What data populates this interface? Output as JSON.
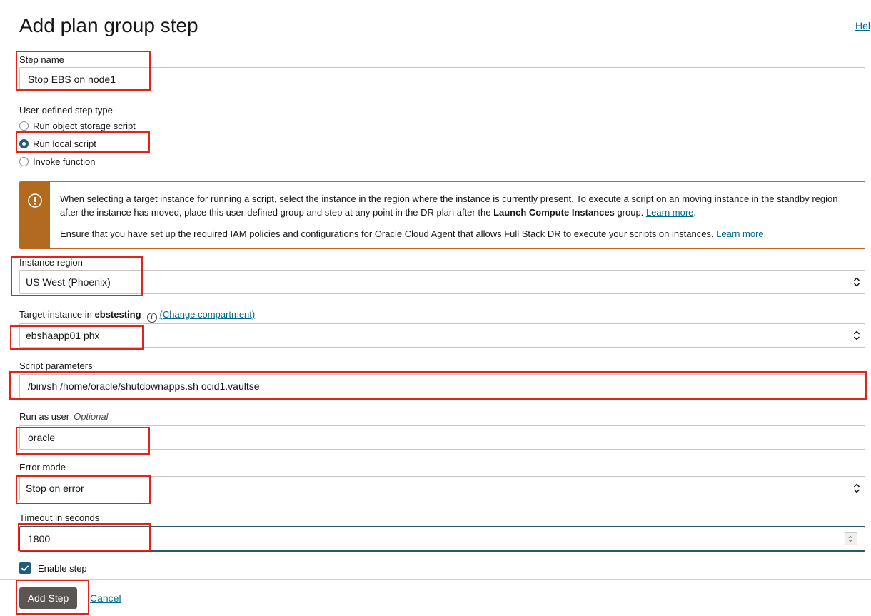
{
  "header": {
    "title": "Add plan group step",
    "help_label": "Help"
  },
  "form": {
    "step_name_label": "Step name",
    "step_name_value": "Stop EBS on node1",
    "step_type_label": "User-defined step type",
    "step_type_options": [
      "Run object storage script",
      "Run local script",
      "Invoke function"
    ],
    "step_type_selected": "Run local script",
    "alert": {
      "p1_text": "When selecting a target instance for running a script, select the instance in the region where the instance is currently present. To execute a script on an moving instance in the standby region after the instance has moved, place this user-defined group and step at any point in the DR plan after the",
      "p1_bold": "Launch Compute Instances",
      "p1_after": "group.",
      "p1_link": "Learn more",
      "p2_text": "Ensure that you have set up the required IAM policies and configurations for Oracle Cloud Agent that allows Full Stack DR to execute your scripts on instances.",
      "p2_link": "Learn more"
    },
    "instance_region_label": "Instance region",
    "instance_region_value": "US West (Phoenix)",
    "target_instance_label": "Target instance in",
    "target_instance_compartment": "ebstesting",
    "change_compartment_link": "(Change compartment)",
    "target_instance_value": "ebshaapp01 phx",
    "script_parameters_label": "Script parameters",
    "script_parameters_value": "/bin/sh /home/oracle/shutdownapps.sh ocid1.vaultse",
    "run_as_user_label": "Run as user",
    "run_as_user_optional": "Optional",
    "run_as_user_value": "oracle",
    "error_mode_label": "Error mode",
    "error_mode_value": "Stop on error",
    "timeout_label": "Timeout in seconds",
    "timeout_value": "1800",
    "enable_step_label": "Enable step",
    "enable_step_checked": true
  },
  "footer": {
    "add_step_label": "Add Step",
    "cancel_label": "Cancel"
  },
  "colors": {
    "accent": "#006b8f",
    "highlight": "#e2231a",
    "warning": "#b26a1f",
    "primary_button": "#5b5652"
  },
  "icons": {
    "alert": "warning-circle-icon",
    "info": "info-icon",
    "select": "select-arrows-icon",
    "check": "checkmark-icon"
  }
}
